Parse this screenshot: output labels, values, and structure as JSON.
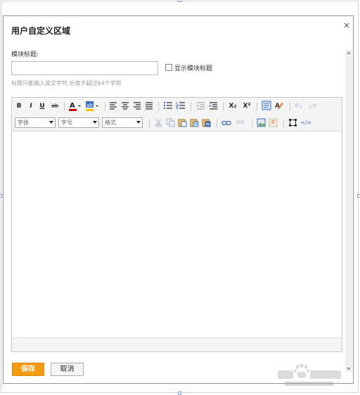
{
  "dialog": {
    "title": "用户自定义区域",
    "close": "×"
  },
  "form": {
    "module_title_label": "模块标题:",
    "module_title_value": "",
    "show_title_label": "显示模块标题",
    "show_title_checked": false,
    "hint": "标题只能输入英文字符,长度不超过64个字符"
  },
  "toolbar": {
    "bold": "B",
    "italic": "I",
    "underline": "U",
    "strike": "ab",
    "font_color": "A",
    "bg_color": "ab",
    "subscript": "X₂",
    "superscript": "X²",
    "source": "</>",
    "font_family": "字体",
    "font_size": "字号",
    "format": "格式",
    "unlink": "ENS"
  },
  "icons": {
    "font_color": "text-color-icon",
    "bg_color": "highlight-icon",
    "align_left": "align-left-icon",
    "align_center": "align-center-icon",
    "align_right": "align-right-icon",
    "justify": "justify-icon",
    "bullet_list": "bullet-list-icon",
    "numbered_list": "numbered-list-icon",
    "outdent": "outdent-icon",
    "indent": "indent-icon",
    "undo": "undo-icon",
    "redo": "redo-icon",
    "cut": "cut-icon",
    "copy": "copy-icon",
    "paste": "paste-icon",
    "link": "link-icon",
    "image": "image-icon",
    "flash": "flash-icon",
    "fullscreen": "fullscreen-icon"
  },
  "buttons": {
    "save": "保存",
    "cancel": "取消"
  },
  "colors": {
    "save_bg": "#f39c12",
    "font_color_bar": "#cc0000",
    "bg_color_bar": "#f2c200",
    "icon_blue": "#3d6fb8"
  }
}
